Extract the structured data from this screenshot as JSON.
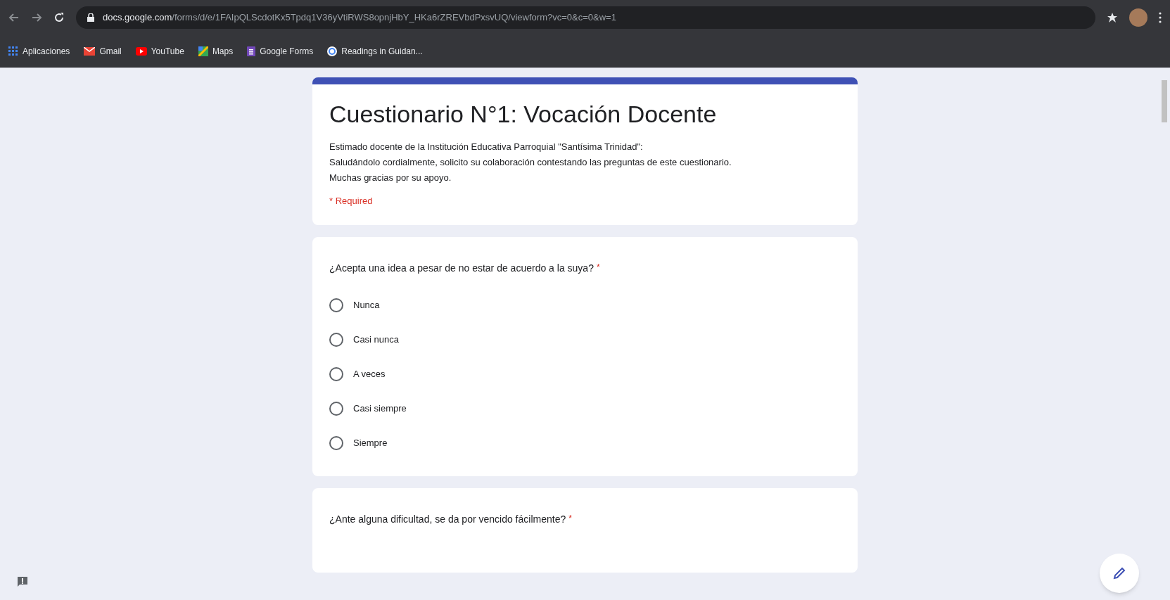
{
  "browser": {
    "url_domain": "docs.google.com",
    "url_path": "/forms/d/e/1FAIpQLScdotKx5Tpdq1V36yVtiRWS8opnjHbY_HKa6rZREVbdPxsvUQ/viewform?vc=0&c=0&w=1"
  },
  "bookmarks": [
    {
      "label": "Aplicaciones",
      "kind": "apps"
    },
    {
      "label": "Gmail",
      "kind": "gmail"
    },
    {
      "label": "YouTube",
      "kind": "youtube"
    },
    {
      "label": "Maps",
      "kind": "maps"
    },
    {
      "label": "Google Forms",
      "kind": "forms"
    },
    {
      "label": "Readings in Guidan...",
      "kind": "google"
    }
  ],
  "form": {
    "title": "Cuestionario N°1: Vocación Docente",
    "description": [
      "Estimado docente de la Institución Educativa Parroquial \"Santísima Trinidad\":",
      "Saludándolo cordialmente, solicito su colaboración contestando las preguntas de este cuestionario.",
      "Muchas gracias por su apoyo."
    ],
    "required_note": "* Required"
  },
  "questions": [
    {
      "text": "¿Acepta una idea a pesar de no estar de acuerdo a la suya?",
      "required_mark": "*",
      "options": [
        {
          "label": "Nunca",
          "selected": false
        },
        {
          "label": "Casi nunca",
          "selected": false
        },
        {
          "label": "A veces",
          "selected": false
        },
        {
          "label": "Casi siempre",
          "selected": false
        },
        {
          "label": "Siempre",
          "selected": false
        }
      ]
    },
    {
      "text": "¿Ante alguna dificultad, se da por vencido fácilmente?",
      "required_mark": "*"
    }
  ]
}
